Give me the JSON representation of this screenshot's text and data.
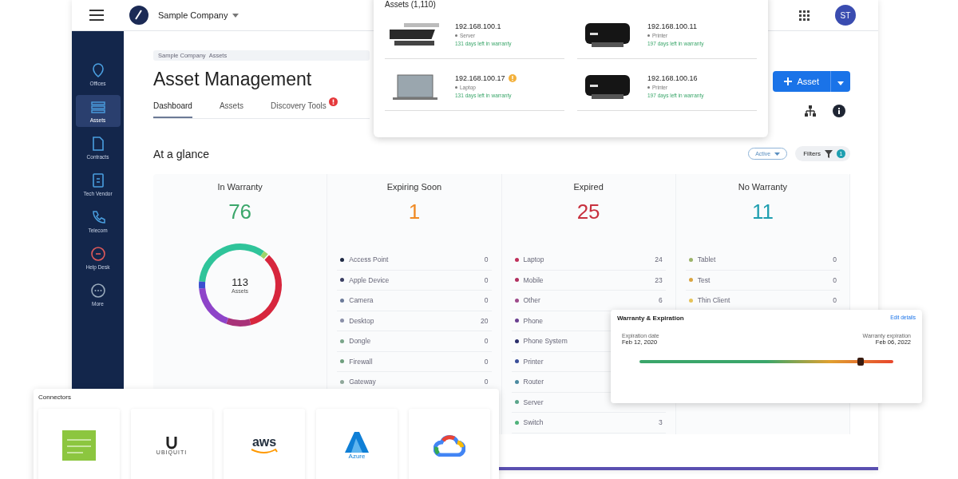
{
  "header": {
    "company": "Sample Company",
    "avatar": "ST"
  },
  "sidebar": {
    "items": [
      {
        "label": "Offices",
        "selected": false
      },
      {
        "label": "Assets",
        "selected": true
      },
      {
        "label": "Contracts",
        "selected": false
      },
      {
        "label": "Tech Vendor",
        "selected": false
      },
      {
        "label": "Telecom",
        "selected": false
      },
      {
        "label": "Help Desk",
        "selected": false
      },
      {
        "label": "More",
        "selected": false
      }
    ]
  },
  "page": {
    "breadcrumb": [
      "Sample Company",
      "Assets"
    ],
    "title": "Asset Management",
    "tabs": [
      {
        "label": "Dashboard",
        "selected": true,
        "alert": false
      },
      {
        "label": "Assets",
        "selected": false,
        "alert": false
      },
      {
        "label": "Discovery Tools",
        "selected": false,
        "alert": true
      }
    ],
    "primary_button": "Asset"
  },
  "glance": {
    "title": "At a glance",
    "status_filter": "Active",
    "filters": {
      "label": "Filters",
      "count": "1"
    },
    "stats": [
      {
        "label": "In Warranty",
        "value": "76",
        "color": "#3aa66a",
        "kind": "donut",
        "center_value": "113",
        "center_label": "Assets"
      },
      {
        "label": "Expiring Soon",
        "value": "1",
        "color": "#f08a24",
        "kind": "list",
        "items": [
          {
            "name": "Access Point",
            "value": "0",
            "color": "#1f2a44"
          },
          {
            "name": "Apple Device",
            "value": "0",
            "color": "#3b3f63"
          },
          {
            "name": "Camera",
            "value": "0",
            "color": "#6b7a99"
          },
          {
            "name": "Desktop",
            "value": "20",
            "color": "#8a8fa8"
          },
          {
            "name": "Dongle",
            "value": "0",
            "color": "#7aa58a"
          },
          {
            "name": "Firewall",
            "value": "0",
            "color": "#6e9f7e"
          },
          {
            "name": "Gateway",
            "value": "0",
            "color": "#8fa79a"
          }
        ]
      },
      {
        "label": "Expired",
        "value": "25",
        "color": "#c8313f",
        "kind": "list",
        "items": [
          {
            "name": "Laptop",
            "value": "24",
            "color": "#c0305a"
          },
          {
            "name": "Mobile",
            "value": "23",
            "color": "#b1305f"
          },
          {
            "name": "Other",
            "value": "6",
            "color": "#9e4a8a"
          },
          {
            "name": "Phone",
            "color": "#6a3f90"
          },
          {
            "name": "Phone System",
            "color": "#2b2f6b"
          },
          {
            "name": "Printer",
            "color": "#3a4f9a"
          },
          {
            "name": "Router",
            "color": "#4a8aa0"
          },
          {
            "name": "Server",
            "color": "#5aa58a"
          },
          {
            "name": "Switch",
            "value": "3",
            "color": "#4eb27a"
          }
        ]
      },
      {
        "label": "No Warranty",
        "value": "11",
        "color": "#1f9fb0",
        "kind": "list",
        "items": [
          {
            "name": "Tablet",
            "value": "0",
            "color": "#9bb36a"
          },
          {
            "name": "Test",
            "value": "0",
            "color": "#d9a441"
          },
          {
            "name": "Thin Client",
            "value": "0",
            "color": "#e6c35a"
          }
        ]
      }
    ]
  },
  "assets_popup": {
    "title": "Assets (1,110)",
    "items": [
      {
        "ip": "192.168.100.1",
        "type": "Server",
        "note": "131 days left in warranty",
        "warning": false,
        "kind": "server"
      },
      {
        "ip": "192.168.100.11",
        "type": "Printer",
        "note": "197 days left in warranty",
        "warning": false,
        "kind": "printer"
      },
      {
        "ip": "192.168.100.17",
        "type": "Laptop",
        "note": "131 days left in warranty",
        "warning": true,
        "kind": "laptop"
      },
      {
        "ip": "192.168.100.16",
        "type": "Printer",
        "note": "197 days left in warranty",
        "warning": false,
        "kind": "printer"
      }
    ]
  },
  "warranty": {
    "title": "Warranty & Expiration",
    "link": "Edit details",
    "start": {
      "label": "Expiration date",
      "date": "Feb 12, 2020"
    },
    "end": {
      "label": "Warranty expiration",
      "date": "Feb 06, 2022"
    },
    "level": 0.87
  },
  "connectors": {
    "title": "Connectors",
    "items": [
      {
        "kind": "meraki"
      },
      {
        "kind": "ubiquiti",
        "label": "UBIQUITI"
      },
      {
        "kind": "aws",
        "label": "aws"
      },
      {
        "kind": "azure",
        "label": "Azure"
      },
      {
        "kind": "gcloud"
      }
    ]
  }
}
